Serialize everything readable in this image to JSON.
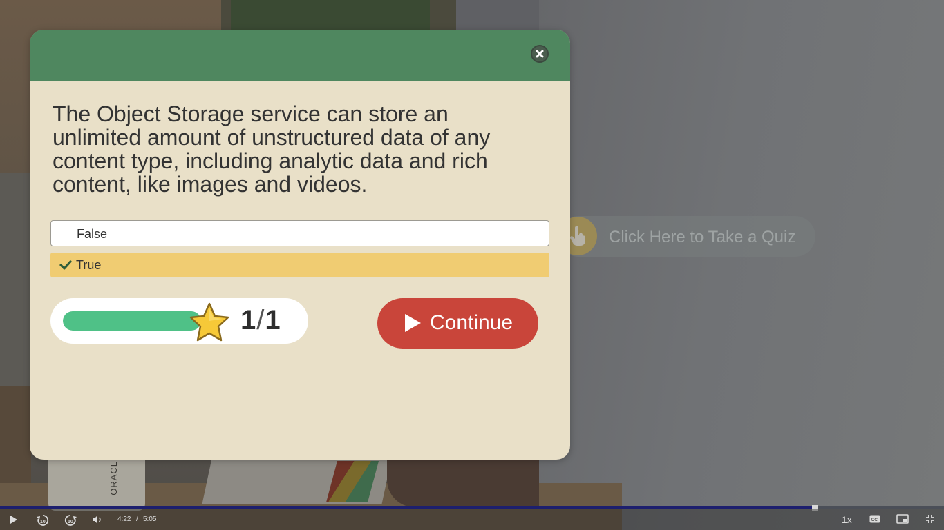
{
  "quiz_prompt": {
    "label": "Click Here to Take a Quiz",
    "icon": "hand-pointer-icon"
  },
  "modal": {
    "close_icon": "close-icon",
    "question": "The Object Storage service can store an unlimited amount of unstructured data of any content type, including analytic data and rich content, like images and videos.",
    "answers": [
      {
        "label": "False",
        "selected": false
      },
      {
        "label": "True",
        "selected": true,
        "icon": "check-icon"
      }
    ],
    "progress": {
      "current": "1",
      "separator": "/",
      "total": "1",
      "fraction": 1.0,
      "icon": "star-icon"
    },
    "continue_label": "Continue",
    "colors": {
      "header": "#4f875f",
      "body": "#e9e0c8",
      "selected_answer": "#f0cc72",
      "continue": "#c9453a",
      "progress_fill": "#4fc187"
    }
  },
  "background": {
    "mug_text": "ORACL"
  },
  "player": {
    "current_time": "4:22",
    "time_separator": "/",
    "duration": "5:05",
    "played_fraction": 0.862,
    "speed": "1x",
    "icons": [
      "play-icon",
      "rewind-10-icon",
      "forward-10-icon",
      "volume-icon",
      "captions-icon",
      "picture-in-picture-icon",
      "exit-fullscreen-icon"
    ]
  }
}
